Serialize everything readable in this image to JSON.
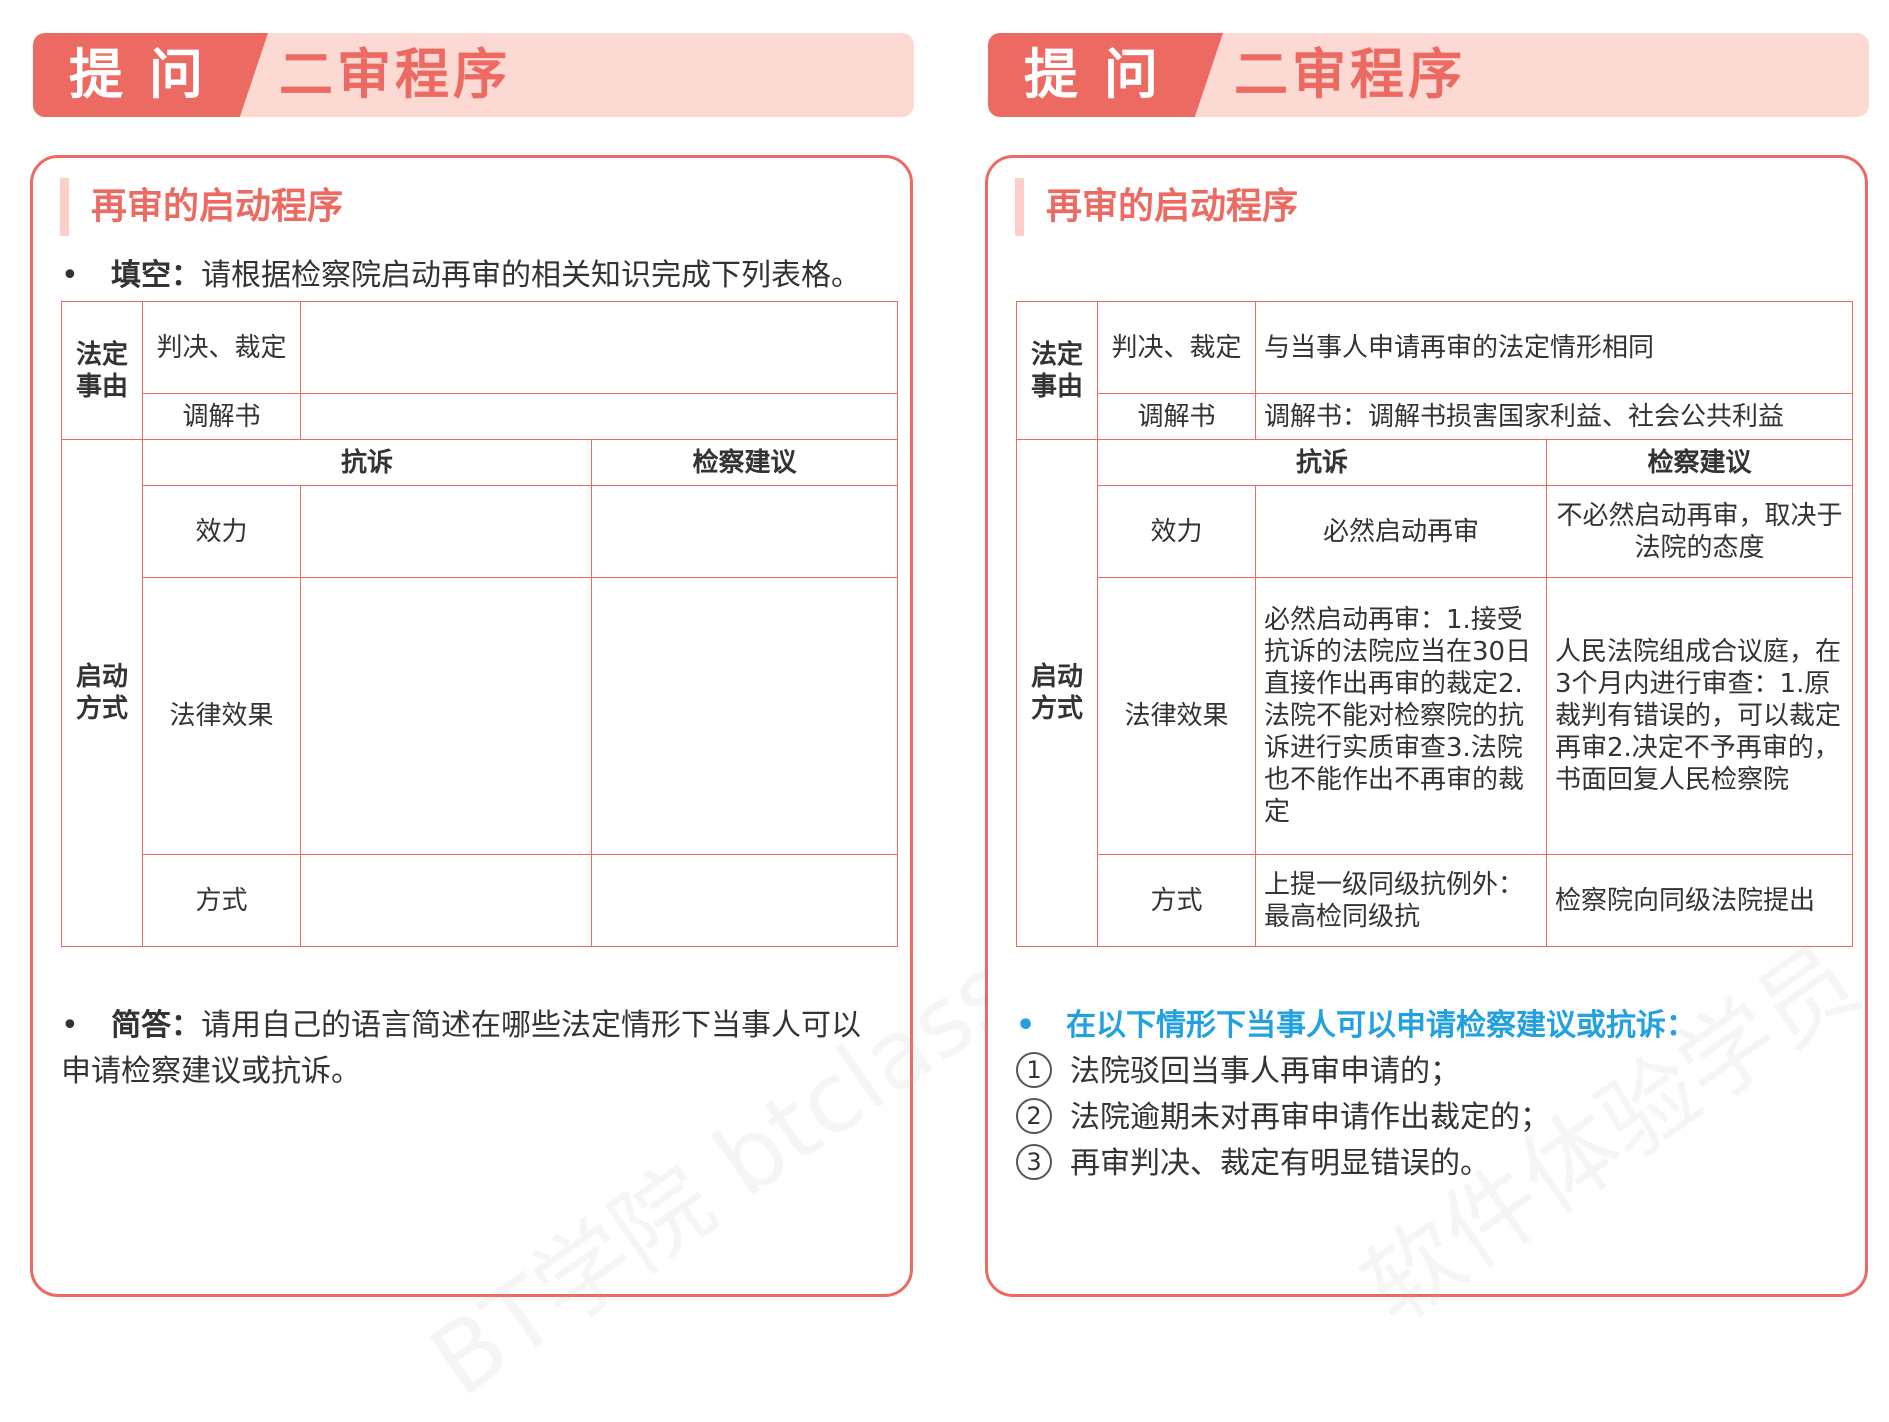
{
  "left": {
    "header": {
      "tag": "提问",
      "title": "二审程序"
    },
    "section_title": "再审的启动程序",
    "instruction": {
      "bold": "填空：",
      "text": "请根据检察院启动再审的相关知识完成下列表格。"
    },
    "table": {
      "group1": "法定事由",
      "group2": "启动方式",
      "row_judgement": "判决、裁定",
      "row_mediation": "调解书",
      "col_protest": "抗诉",
      "col_suggest": "检察建议",
      "row_effect": "效力",
      "row_legal": "法律效果",
      "row_method": "方式"
    },
    "question": {
      "bold": "简答：",
      "text": "请用自己的语言简述在哪些法定情形下当事人可以申请检察建议或抗诉。"
    },
    "watermark": "BT学院 btclass.cn"
  },
  "right": {
    "header": {
      "tag": "提问",
      "title": "二审程序"
    },
    "section_title": "再审的启动程序",
    "table": {
      "group1": "法定事由",
      "group2": "启动方式",
      "row_judgement": "判决、裁定",
      "row_mediation": "调解书",
      "col_protest": "抗诉",
      "col_suggest": "检察建议",
      "row_effect": "效力",
      "row_legal": "法律效果",
      "row_method": "方式",
      "ans_judgement": "与当事人申请再审的法定情形相同",
      "ans_mediation": "调解书：调解书损害国家利益、社会公共利益",
      "ans_effect_protest": "必然启动再审",
      "ans_effect_suggest": "不必然启动再审，取决于法院的态度",
      "ans_legal_protest": "必然启动再审：1.接受抗诉的法院应当在30日直接作出再审的裁定2.法院不能对检察院的抗诉进行实质审查3.法院也不能作出不再审的裁定",
      "ans_legal_suggest": "人民法院组成合议庭，在3个月内进行审查：1.原裁判有错误的，可以裁定再审2.决定不予再审的，书面回复人民检察院",
      "ans_method_protest": "上提一级同级抗例外：最高检同级抗",
      "ans_method_suggest": "检察院向同级法院提出"
    },
    "answer_heading": "在以下情形下当事人可以申请检察建议或抗诉：",
    "answers": [
      {
        "num": "1",
        "text": "法院驳回当事人再审申请的；"
      },
      {
        "num": "2",
        "text": "法院逾期未对再审申请作出裁定的；"
      },
      {
        "num": "3",
        "text": "再审判决、裁定有明显错误的。"
      }
    ],
    "watermark": "软件体验学员"
  },
  "colors": {
    "accent": "#ec6a61",
    "header_bg": "#fcd9d3",
    "answer_blue": "#22a0e0"
  }
}
